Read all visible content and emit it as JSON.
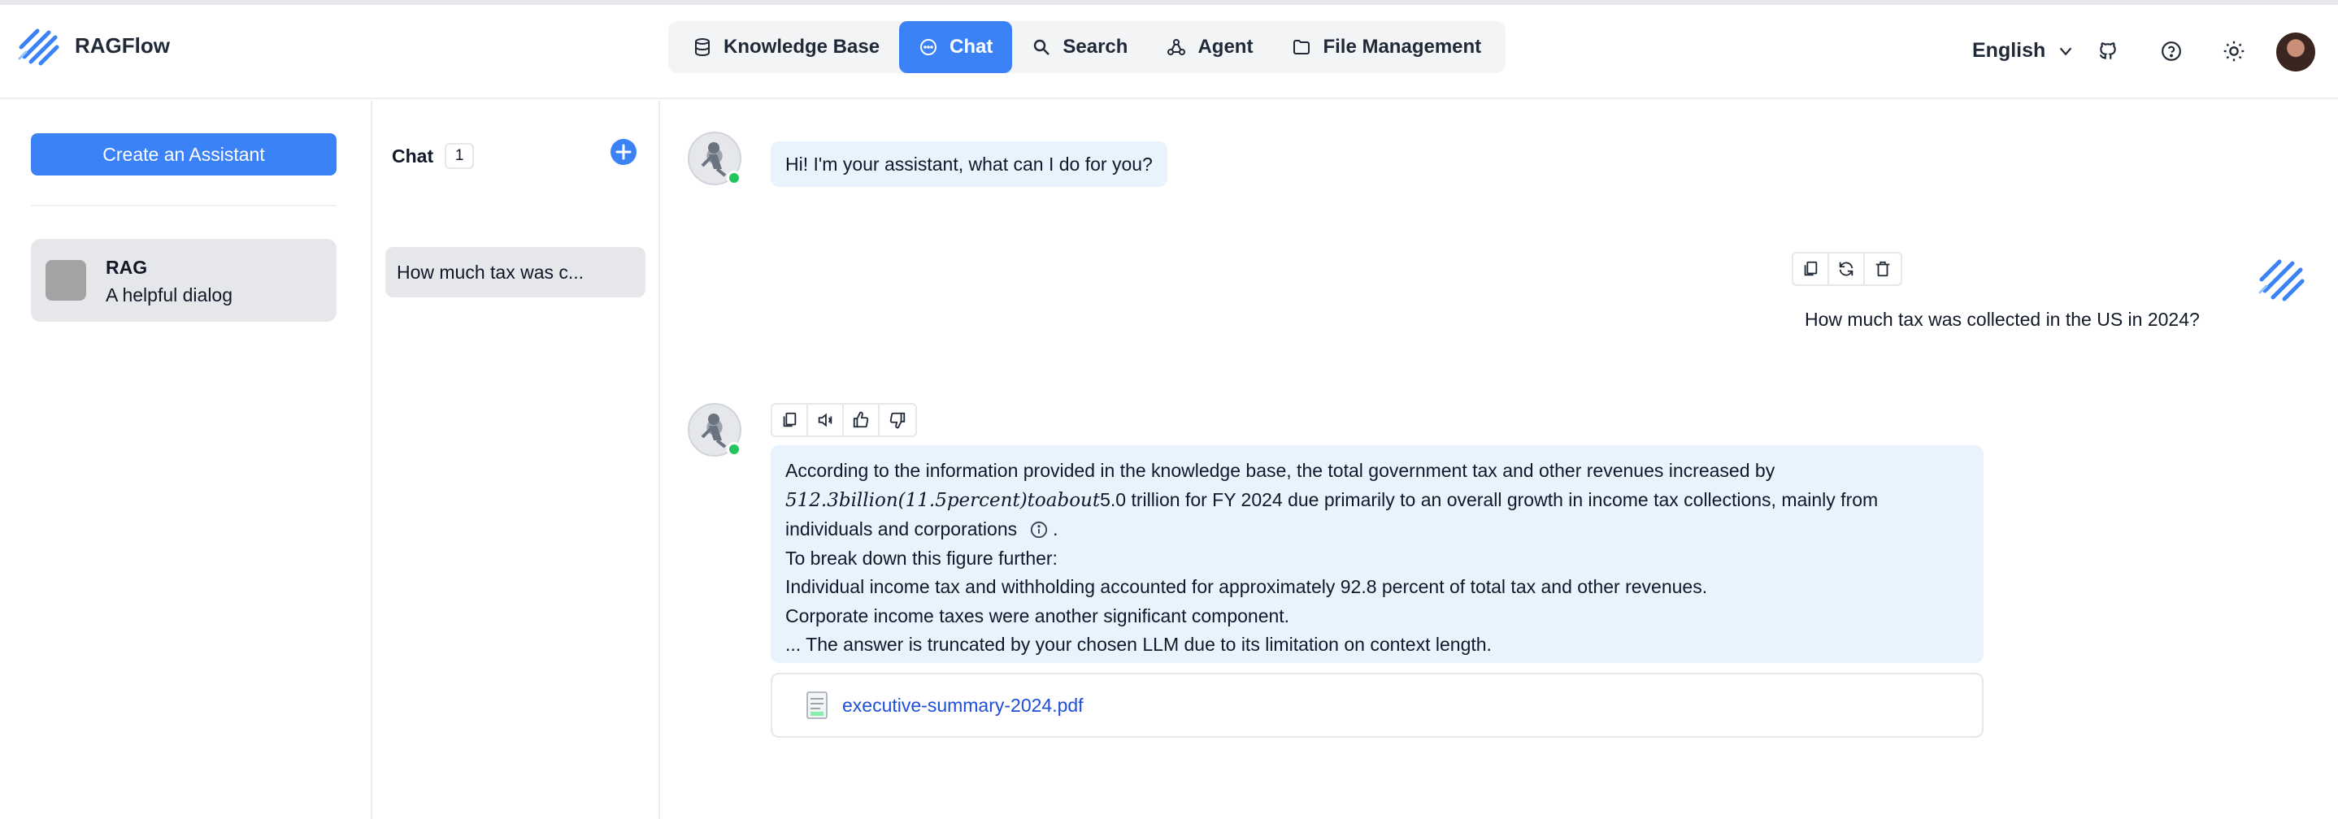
{
  "app": {
    "name": "RAGFlow"
  },
  "nav": {
    "items": [
      {
        "label": "Knowledge Base",
        "icon": "database-icon",
        "active": false
      },
      {
        "label": "Chat",
        "icon": "chat-bubble-icon",
        "active": true
      },
      {
        "label": "Search",
        "icon": "search-icon",
        "active": false
      },
      {
        "label": "Agent",
        "icon": "agent-graph-icon",
        "active": false
      },
      {
        "label": "File Management",
        "icon": "folder-icon",
        "active": false
      }
    ],
    "language": "English",
    "icons": [
      "github-icon",
      "help-icon",
      "theme-sun-icon"
    ]
  },
  "assistants": {
    "create_label": "Create an Assistant",
    "items": [
      {
        "name": "RAG",
        "description": "A helpful dialog"
      }
    ]
  },
  "chats": {
    "title": "Chat",
    "count": "1",
    "items": [
      {
        "title": "How much tax was c..."
      }
    ]
  },
  "conversation": {
    "greeting": "Hi! I'm your assistant, what can I do for you?",
    "user_question": "How much tax was collected in the US in 2024?",
    "answer": {
      "line1": "According to the information provided in the knowledge base, the total government tax and other revenues increased by",
      "line2_math": "512.3billion(11.5percent)toabout",
      "line2_rest": "5.0 trillion for FY 2024 due primarily to an overall growth in income tax collections, mainly from",
      "line3": "individuals and corporations",
      "line3_end": ".",
      "line4": "To break down this figure further:",
      "line5": "Individual income tax and withholding accounted for approximately 92.8 percent of total tax and other revenues.",
      "line6": "Corporate income taxes were another significant component.",
      "line7": "... The answer is truncated by your chosen LLM due to its limitation on context length."
    },
    "reference_file": "executive-summary-2024.pdf"
  },
  "colors": {
    "accent": "#3b82f6",
    "bubble": "#e8f3fd",
    "online": "#22c55e",
    "link": "#1d4ed8"
  }
}
